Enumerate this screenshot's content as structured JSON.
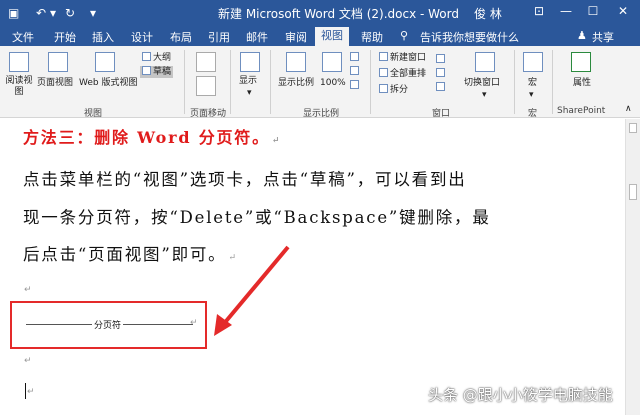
{
  "titlebar": {
    "title": "新建 Microsoft Word 文档 (2).docx - Word",
    "user": "俊 林",
    "icons": [
      "save-icon",
      "undo-icon",
      "redo-icon",
      "customize-icon",
      "ribbon-options-icon",
      "minimize-icon",
      "maximize-icon",
      "close-icon"
    ]
  },
  "tabs": [
    "文件",
    "开始",
    "插入",
    "设计",
    "布局",
    "引用",
    "邮件",
    "审阅",
    "视图",
    "帮助"
  ],
  "active_tab": "视图",
  "tell_me": "告诉我你想要做什么",
  "share": "共享",
  "ribbon": {
    "views": {
      "read_mode": "阅读视图",
      "print_layout": "页面视图",
      "web_layout": "Web 版式视图",
      "outline": "大纲",
      "draft": "草稿",
      "group": "视图"
    },
    "page_movement": {
      "label": "页面移动"
    },
    "show": {
      "label": "显示"
    },
    "zoom": {
      "zoom": "显示比例",
      "percent": "100%",
      "group": "显示比例"
    },
    "window": {
      "new_window": "新建窗口",
      "arrange_all": "全部重排",
      "split": "拆分",
      "switch": "切换窗口",
      "group": "窗口"
    },
    "macros": {
      "label": "宏",
      "group": "宏"
    },
    "sharepoint": {
      "label": "属性",
      "group": "SharePoint"
    }
  },
  "document": {
    "heading": "方法三：删除 Word 分页符。",
    "para_lines": [
      "点击菜单栏的“视图”选项卡，点击“草稿”，可以看到出",
      "现一条分页符，按“Delete”或“Backspace”键删除，最",
      "后点击“页面视图”即可。"
    ],
    "page_break_label": "分页符",
    "para_mark": "↵"
  },
  "watermark": "头条 @跟小小筱学电脑技能",
  "colors": {
    "accent": "#2b579a",
    "highlight": "#e42a2a",
    "heading": "#e01b1b"
  }
}
